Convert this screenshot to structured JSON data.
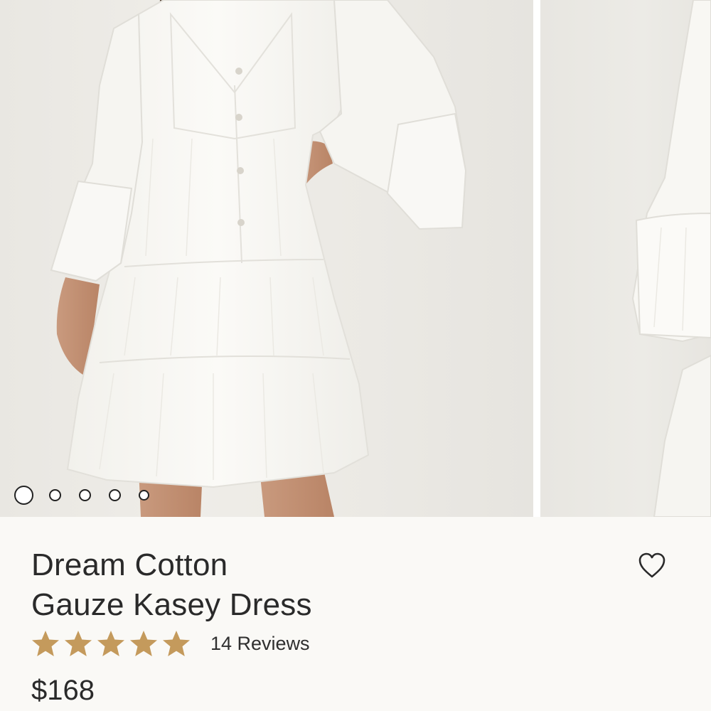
{
  "product": {
    "title_line1": "Dream Cotton",
    "title_line2": "Gauze Kasey Dress",
    "rating": 5,
    "reviews_text": "14 Reviews",
    "price": "$168"
  },
  "carousel": {
    "slide_count": 5,
    "active_index": 0
  },
  "icons": {
    "favorite": "heart-outline-icon",
    "star": "star-icon"
  },
  "colors": {
    "star": "#c49a5c",
    "background": "#faf9f6",
    "dress": "#f8f7f3"
  }
}
